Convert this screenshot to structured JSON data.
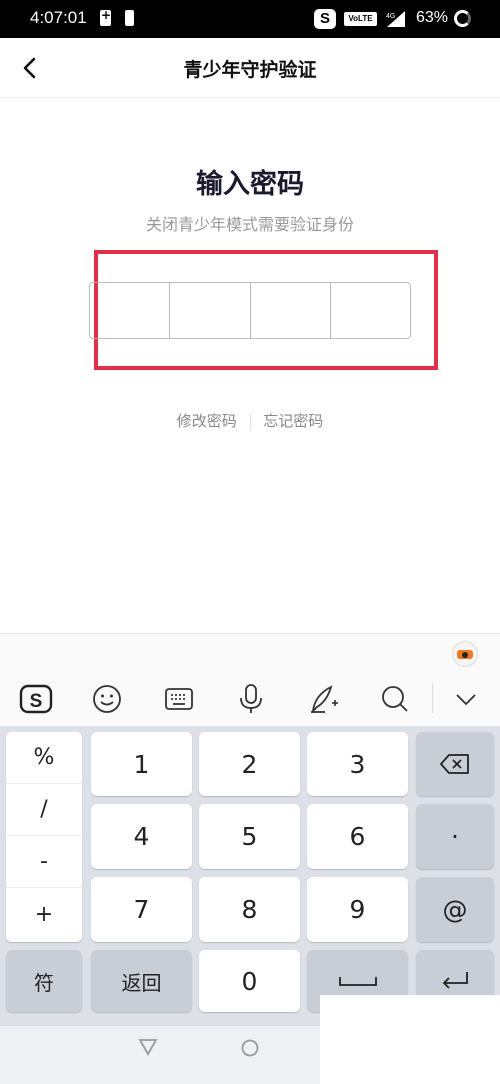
{
  "status_bar": {
    "time": "4:07:01",
    "volte_label": "VoLTE",
    "network_label": "4G",
    "battery_percent": "63%",
    "sogou_label": "S"
  },
  "nav": {
    "title": "青少年守护验证"
  },
  "main": {
    "title": "输入密码",
    "subtitle": "关闭青少年模式需要验证身份",
    "pin_value": "",
    "link_modify": "修改密码",
    "link_forgot": "忘记密码"
  },
  "keyboard": {
    "toolbar_icons": [
      "sogou-logo-icon",
      "emoji-icon",
      "keyboard-icon",
      "microphone-icon",
      "handwriting-icon",
      "search-icon",
      "collapse-icon"
    ],
    "symbols": [
      "%",
      "/",
      "-",
      "+"
    ],
    "digits": [
      "1",
      "2",
      "3",
      "4",
      "5",
      "6",
      "7",
      "8",
      "9",
      "0"
    ],
    "dot": "·",
    "at": "@",
    "fu": "符",
    "back_label": "返回"
  },
  "colors": {
    "highlight": "#e0304a",
    "title": "#1a1a2e",
    "subtle": "#999999"
  }
}
